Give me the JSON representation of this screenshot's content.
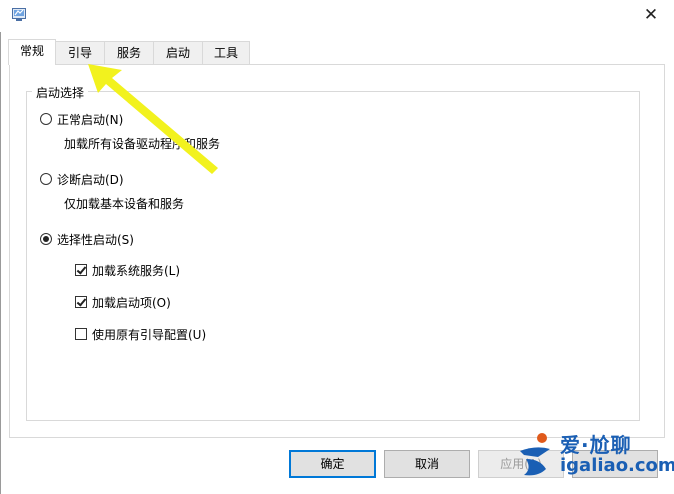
{
  "window": {
    "close_glyph": "✕"
  },
  "tabs": [
    {
      "label": "常规",
      "active": true
    },
    {
      "label": "引导",
      "active": false
    },
    {
      "label": "服务",
      "active": false
    },
    {
      "label": "启动",
      "active": false
    },
    {
      "label": "工具",
      "active": false
    }
  ],
  "startup_group": {
    "title": "启动选择",
    "normal": {
      "label": "正常启动(N)",
      "desc": "加载所有设备驱动程序和服务",
      "checked": false
    },
    "diagnostic": {
      "label": "诊断启动(D)",
      "desc": "仅加载基本设备和服务",
      "checked": false
    },
    "selective": {
      "label": "选择性启动(S)",
      "checked": true
    },
    "options": [
      {
        "label": "加载系统服务(L)",
        "checked": true
      },
      {
        "label": "加载启动项(O)",
        "checked": true
      },
      {
        "label": "使用原有引导配置(U)",
        "checked": false
      }
    ]
  },
  "buttons": {
    "ok": "确定",
    "cancel": "取消",
    "apply": "应用(A)"
  },
  "watermark": {
    "top": "爱·尬聊",
    "bottom": "igaliao.com"
  },
  "colors": {
    "arrow": "#f2f21e",
    "accent": "#0078d7",
    "watermark": "#1a5fb4"
  }
}
